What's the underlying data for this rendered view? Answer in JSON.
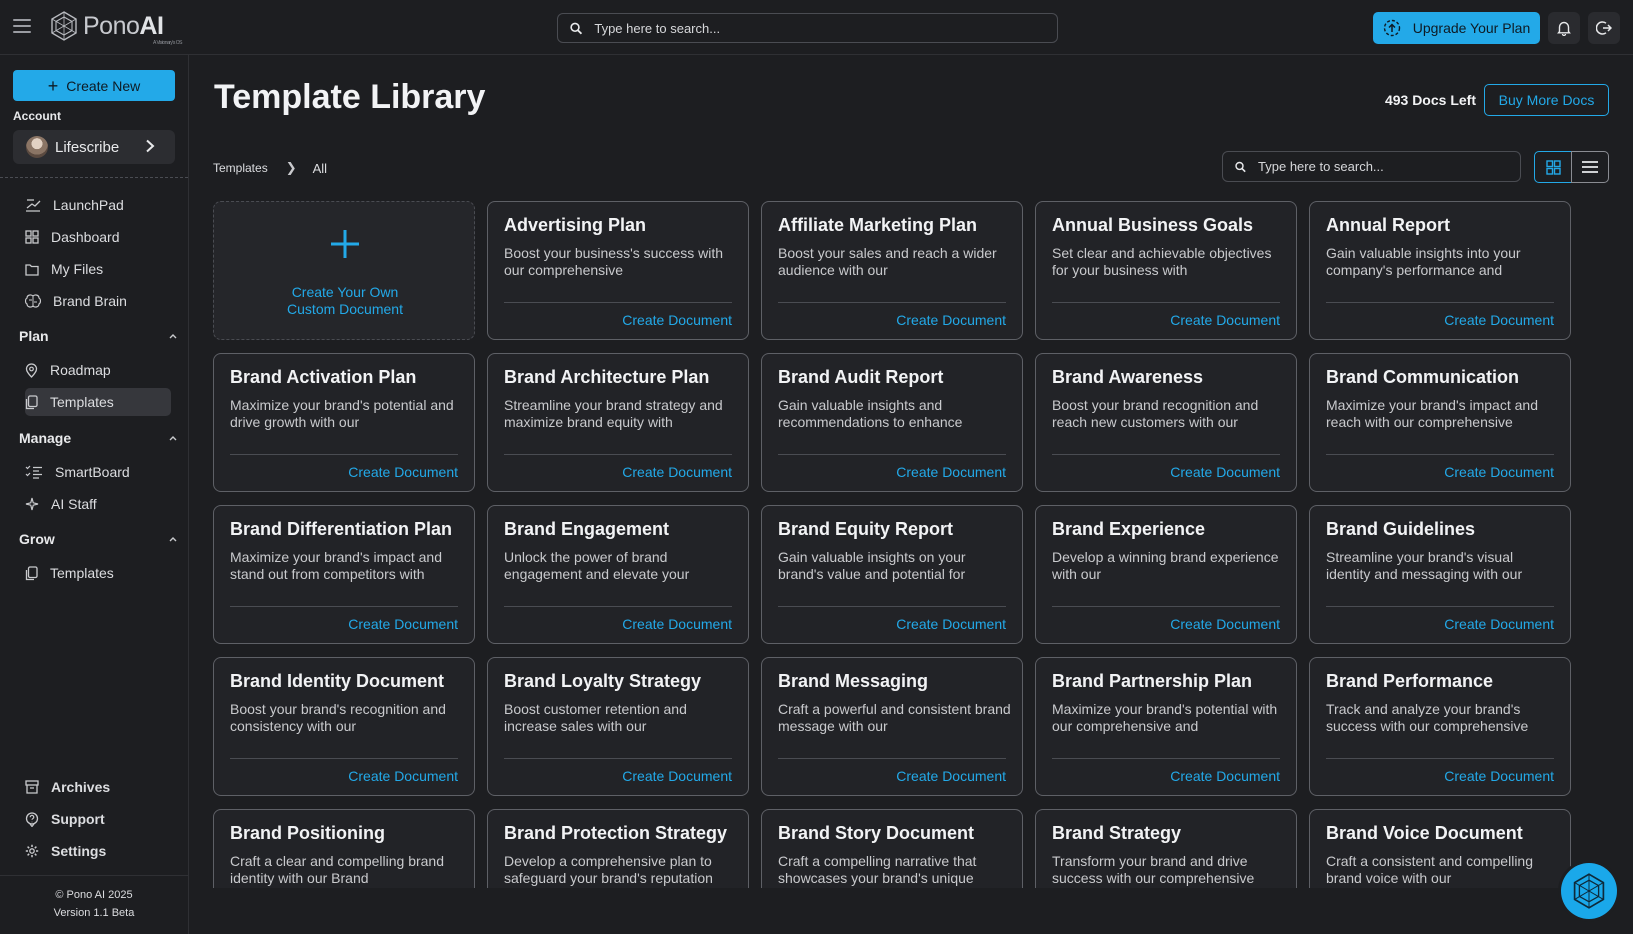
{
  "header": {
    "logo_prefix": "Pono",
    "logo_suffix": "AI",
    "logo_tag": "A Visionary's OS",
    "search_placeholder": "Type here to search...",
    "upgrade_label": "Upgrade Your Plan"
  },
  "sidebar": {
    "create_new_label": "Create New",
    "account_label": "Account",
    "account_name": "Lifescribe",
    "top_items": [
      {
        "label": "LaunchPad",
        "icon": "launchpad-icon"
      },
      {
        "label": "Dashboard",
        "icon": "dashboard-icon"
      },
      {
        "label": "My Files",
        "icon": "folder-icon"
      },
      {
        "label": "Brand Brain",
        "icon": "brain-icon"
      }
    ],
    "sections": [
      {
        "title": "Plan",
        "items": [
          {
            "label": "Roadmap",
            "icon": "map-pin-icon"
          },
          {
            "label": "Templates",
            "icon": "templates-icon"
          }
        ]
      },
      {
        "title": "Manage",
        "items": [
          {
            "label": "SmartBoard",
            "icon": "checklist-icon"
          },
          {
            "label": "AI Staff",
            "icon": "sparkle-icon"
          }
        ]
      },
      {
        "title": "Grow",
        "items": [
          {
            "label": "Templates",
            "icon": "templates-icon"
          }
        ]
      }
    ],
    "bottom_items": [
      {
        "label": "Archives",
        "icon": "archive-icon"
      },
      {
        "label": "Support",
        "icon": "support-icon"
      },
      {
        "label": "Settings",
        "icon": "gear-icon"
      }
    ],
    "copyright": "© Pono AI 2025",
    "version": "Version 1.1 Beta"
  },
  "main": {
    "title": "Template Library",
    "docs_left": "493 Docs Left",
    "buy_more_label": "Buy More Docs",
    "breadcrumb": [
      "Templates",
      "All"
    ],
    "search_placeholder": "Type here to search...",
    "custom_card": {
      "line1": "Create Your Own",
      "line2": "Custom Document"
    },
    "cta_label": "Create Document",
    "templates": [
      {
        "title": "Advertising Plan",
        "desc": "Boost your business's success with our comprehensive"
      },
      {
        "title": "Affiliate Marketing Plan",
        "desc": "Boost your sales and reach a wider audience with our"
      },
      {
        "title": "Annual Business Goals",
        "desc": "Set clear and achievable objectives for your business with"
      },
      {
        "title": "Annual Report",
        "desc": "Gain valuable insights into your company's performance and"
      },
      {
        "title": "Brand Activation Plan",
        "desc": "Maximize your brand's potential and drive growth with our"
      },
      {
        "title": "Brand Architecture Plan",
        "desc": "Streamline your brand strategy and maximize brand equity with"
      },
      {
        "title": "Brand Audit Report",
        "desc": "Gain valuable insights and recommendations to enhance"
      },
      {
        "title": "Brand Awareness",
        "desc": "Boost your brand recognition and reach new customers with our"
      },
      {
        "title": "Brand Communication",
        "desc": "Maximize your brand's impact and reach with our comprehensive"
      },
      {
        "title": "Brand Differentiation Plan",
        "desc": "Maximize your brand's impact and stand out from competitors with"
      },
      {
        "title": "Brand Engagement",
        "desc": "Unlock the power of brand engagement and elevate your"
      },
      {
        "title": "Brand Equity Report",
        "desc": "Gain valuable insights on your brand's value and potential for"
      },
      {
        "title": "Brand Experience",
        "desc": "Develop a winning brand experience with our"
      },
      {
        "title": "Brand Guidelines",
        "desc": "Streamline your brand's visual identity and messaging with our"
      },
      {
        "title": "Brand Identity Document",
        "desc": "Boost your brand's recognition and consistency with our"
      },
      {
        "title": "Brand Loyalty Strategy",
        "desc": "Boost customer retention and increase sales with our"
      },
      {
        "title": "Brand Messaging",
        "desc": "Craft a powerful and consistent brand message with our"
      },
      {
        "title": "Brand Partnership Plan",
        "desc": "Maximize your brand's potential with our comprehensive and"
      },
      {
        "title": "Brand Performance",
        "desc": "Track and analyze your brand's success with our comprehensive"
      },
      {
        "title": "Brand Positioning",
        "desc": "Craft a clear and compelling brand identity with our Brand"
      },
      {
        "title": "Brand Protection Strategy",
        "desc": "Develop a comprehensive plan to safeguard your brand's reputation"
      },
      {
        "title": "Brand Story Document",
        "desc": "Craft a compelling narrative that showcases your brand's unique"
      },
      {
        "title": "Brand Strategy",
        "desc": "Transform your brand and drive success with our comprehensive"
      },
      {
        "title": "Brand Voice Document",
        "desc": "Craft a consistent and compelling brand voice with our"
      }
    ]
  },
  "colors": {
    "accent": "#23a9e8",
    "background": "#1d1e21",
    "card": "#222327"
  }
}
